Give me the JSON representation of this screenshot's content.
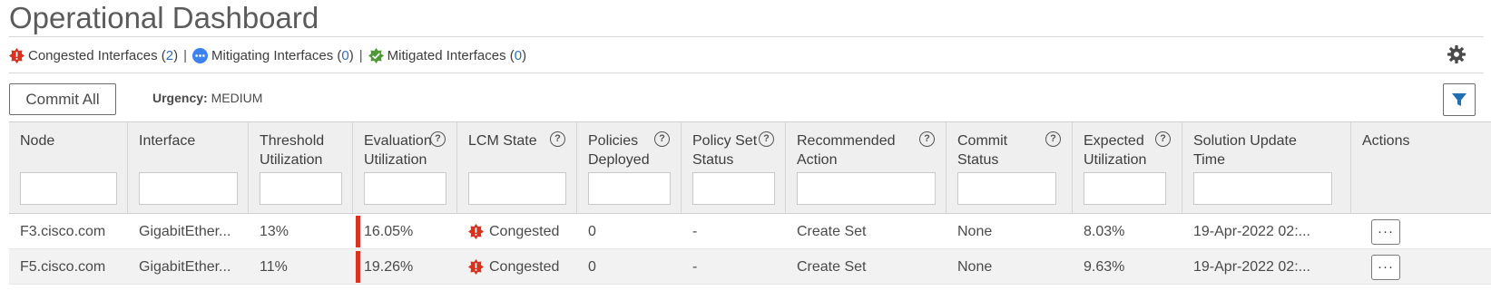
{
  "page_title": "Operational Dashboard",
  "summary": {
    "congested": {
      "label": "Congested Interfaces",
      "open": "(",
      "count": "2",
      "close": ")"
    },
    "mitigating": {
      "label": "Mitigating Interfaces",
      "open": "(",
      "count": "0",
      "close": ")"
    },
    "mitigated": {
      "label": "Mitigated Interfaces",
      "open": "(",
      "count": "0",
      "close": ")"
    },
    "separator": "|"
  },
  "toolbar": {
    "commit_all_label": "Commit All",
    "urgency_label": "Urgency:",
    "urgency_value": "MEDIUM"
  },
  "table": {
    "columns": [
      {
        "label": "Node"
      },
      {
        "label": "Interface"
      },
      {
        "label": "Threshold\nUtilization"
      },
      {
        "label": "Evaluation\nUtilization"
      },
      {
        "label": "LCM State"
      },
      {
        "label": "Policies\nDeployed"
      },
      {
        "label": "Policy Set\nStatus"
      },
      {
        "label": "Recommended\nAction"
      },
      {
        "label": "Commit\nStatus"
      },
      {
        "label": "Expected\nUtilization"
      },
      {
        "label": "Solution Update\nTime"
      },
      {
        "label": "Actions"
      }
    ],
    "help_glyph": "?",
    "rows": [
      {
        "node": "F3.cisco.com",
        "interface": "GigabitEther...",
        "threshold": "13%",
        "evaluation": "16.05%",
        "lcm_state": "Congested",
        "policies": "0",
        "policy_set_status": "-",
        "recommended_action": "Create Set",
        "commit_status": "None",
        "expected": "8.03%",
        "update_time": "19-Apr-2022 02:..."
      },
      {
        "node": "F5.cisco.com",
        "interface": "GigabitEther...",
        "threshold": "11%",
        "evaluation": "19.26%",
        "lcm_state": "Congested",
        "policies": "0",
        "policy_set_status": "-",
        "recommended_action": "Create Set",
        "commit_status": "None",
        "expected": "9.63%",
        "update_time": "19-Apr-2022 02:..."
      }
    ],
    "more_glyph": "···"
  },
  "colors": {
    "congested": "#d9321f",
    "mitigating": "#3b82f0",
    "mitigated": "#4e9a36",
    "link": "#2f6fae"
  },
  "icons": {
    "congested": "alert-burst-icon",
    "mitigating": "ellipsis-circle-icon",
    "mitigated": "check-badge-icon",
    "settings": "gear-icon",
    "filter": "filter-icon"
  }
}
